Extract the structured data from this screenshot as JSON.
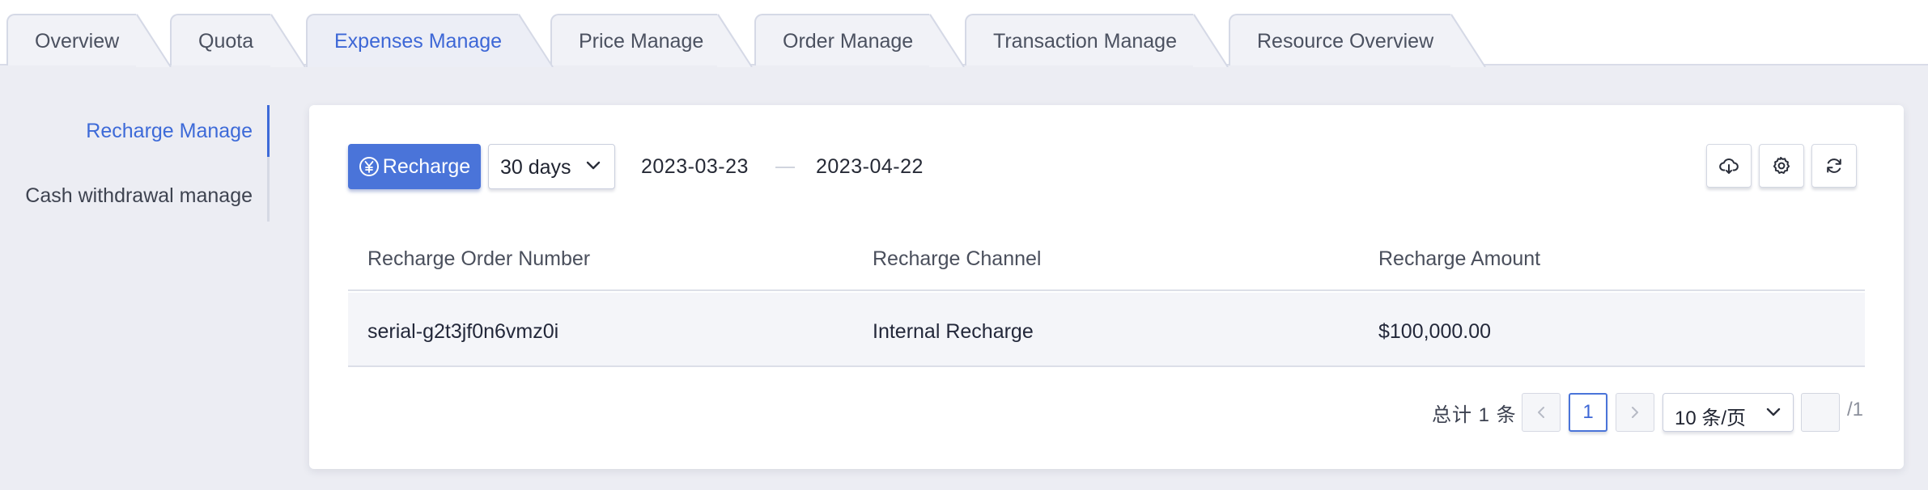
{
  "tabs": [
    {
      "label": "Overview",
      "active": false
    },
    {
      "label": "Quota",
      "active": false
    },
    {
      "label": "Expenses Manage",
      "active": true
    },
    {
      "label": "Price Manage",
      "active": false
    },
    {
      "label": "Order Manage",
      "active": false
    },
    {
      "label": "Transaction Manage",
      "active": false
    },
    {
      "label": "Resource Overview",
      "active": false
    }
  ],
  "sidebar": {
    "items": [
      {
        "label": "Recharge Manage",
        "active": true
      },
      {
        "label": "Cash withdrawal manage",
        "active": false
      }
    ]
  },
  "toolbar": {
    "recharge_label": "Recharge",
    "recharge_icon": "yuan-circle-icon",
    "range_select": "30 days",
    "date_start": "2023-03-23",
    "date_end": "2023-04-22",
    "actions": [
      "cloud-download-icon",
      "settings-icon",
      "refresh-icon"
    ]
  },
  "table": {
    "columns": [
      "Recharge Order Number",
      "Recharge Channel",
      "Recharge Amount"
    ],
    "rows": [
      [
        "serial-g2t3jf0n6vmz0i",
        "Internal Recharge",
        "$100,000.00"
      ]
    ]
  },
  "pagination": {
    "total_text": "总计 1 条",
    "current_page": "1",
    "page_size": "10 条/页",
    "jump_value": "",
    "total_pages_text": "/1"
  },
  "colors": {
    "accent": "#4a74d9",
    "active_text": "#3d67d6",
    "page_bg": "#ecedf3"
  }
}
